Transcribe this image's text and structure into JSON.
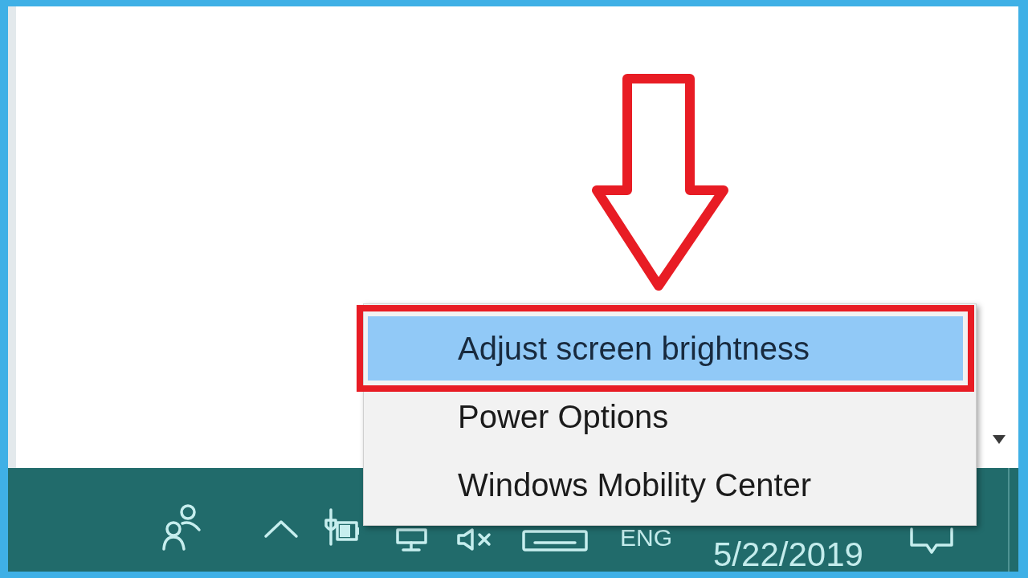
{
  "context_menu": {
    "items": [
      {
        "label": "Adjust screen brightness",
        "selected": true,
        "outlined": true
      },
      {
        "label": "Power Options",
        "selected": false,
        "outlined": false
      },
      {
        "label": "Windows Mobility Center",
        "selected": false,
        "outlined": false
      }
    ]
  },
  "taskbar": {
    "language": "ENG",
    "date": "5/22/2019"
  }
}
